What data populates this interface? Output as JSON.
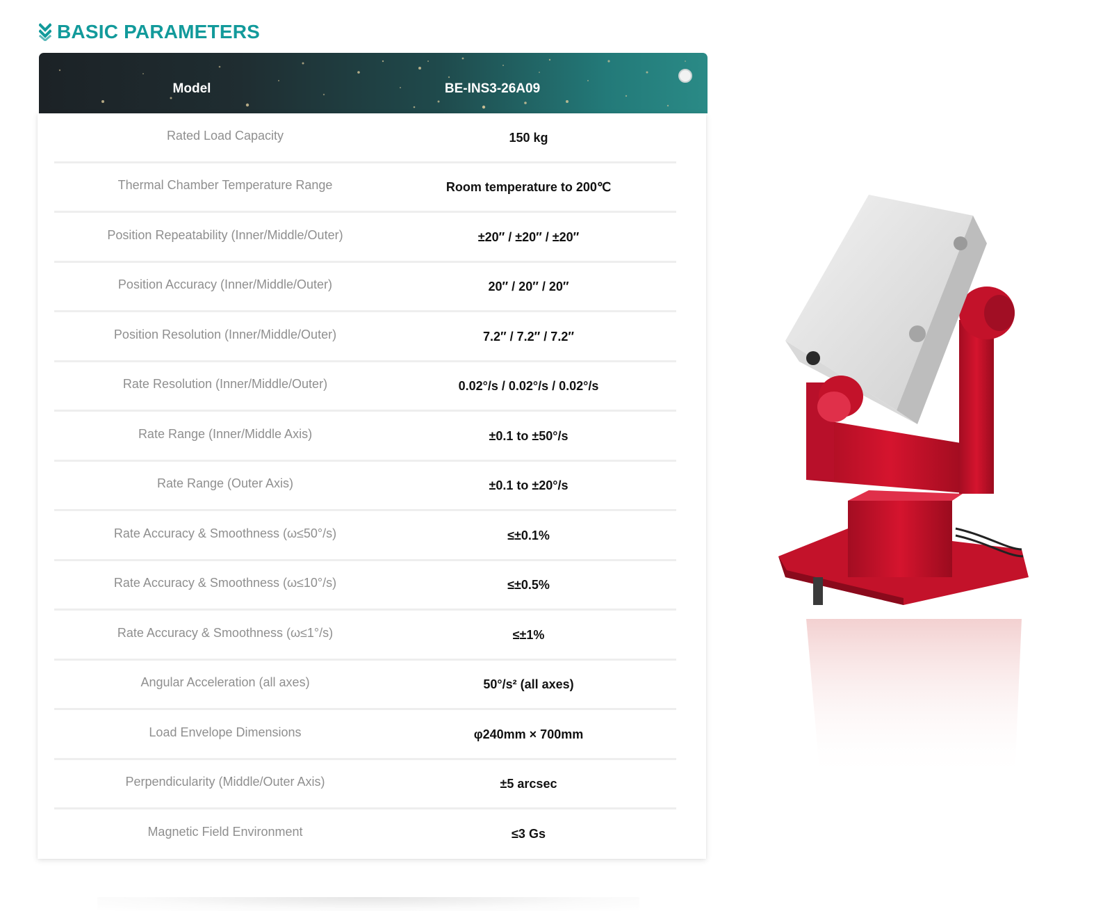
{
  "section": {
    "title": "BASIC PARAMETERS",
    "icon": "double-chevron-down-icon",
    "accent_color": "#129a9b"
  },
  "table": {
    "header": {
      "label": "Model",
      "value": "BE-INS3-26A09"
    },
    "rows": [
      {
        "label": "Rated Load Capacity",
        "value": "150 kg"
      },
      {
        "label": "Thermal Chamber Temperature Range",
        "value": "Room temperature to 200℃"
      },
      {
        "label": "Position Repeatability (Inner/Middle/Outer)",
        "value": "±20″ / ±20″ / ±20″"
      },
      {
        "label": "Position Accuracy (Inner/Middle/Outer)",
        "value": "20″ / 20″ / 20″"
      },
      {
        "label": "Position Resolution (Inner/Middle/Outer)",
        "value": "7.2″ / 7.2″ / 7.2″"
      },
      {
        "label": "Rate Resolution (Inner/Middle/Outer)",
        "value": "0.02°/s / 0.02°/s / 0.02°/s"
      },
      {
        "label": "Rate Range (Inner/Middle Axis)",
        "value": "±0.1 to ±50°/s"
      },
      {
        "label": "Rate Range (Outer Axis)",
        "value": "±0.1 to ±20°/s"
      },
      {
        "label": "Rate Accuracy & Smoothness (ω≤50°/s)",
        "value": "≤±0.1%"
      },
      {
        "label": "Rate Accuracy & Smoothness (ω≤10°/s)",
        "value": "≤±0.5%"
      },
      {
        "label": "Rate Accuracy & Smoothness (ω≤1°/s)",
        "value": "≤±1%"
      },
      {
        "label": "Angular Acceleration (all axes)",
        "value": "50°/s² (all axes)"
      },
      {
        "label": "Load Envelope Dimensions",
        "value": "φ240mm × 700mm"
      },
      {
        "label": "Perpendicularity (Middle/Outer Axis)",
        "value": "±5 arcsec"
      },
      {
        "label": "Magnetic Field Environment",
        "value": "≤3 Gs"
      }
    ]
  },
  "colors": {
    "product_red": "#c8102e",
    "header_dark": "#1c2226",
    "header_teal": "#2a8a86"
  }
}
